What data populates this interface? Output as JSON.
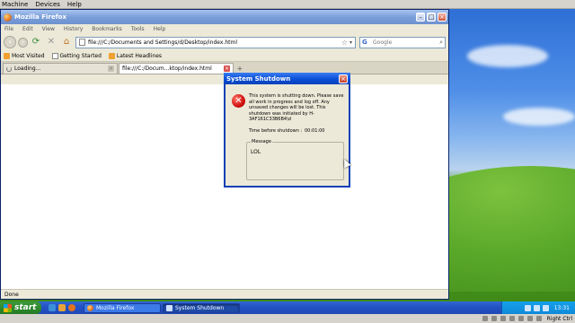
{
  "host": {
    "menu": [
      "Machine",
      "Devices",
      "Help"
    ],
    "status_right": "Right Ctrl"
  },
  "firefox": {
    "title": "Mozilla Firefox",
    "menu": [
      "File",
      "Edit",
      "View",
      "History",
      "Bookmarks",
      "Tools",
      "Help"
    ],
    "url": "file:///C:/Documents and Settings/d/Desktop/index.html",
    "search_placeholder": "Google",
    "bookmarks": [
      "Most Visited",
      "Getting Started",
      "Latest Headlines"
    ],
    "tabs": [
      {
        "label": "Loading..."
      },
      {
        "label": "file:///C:/Docum...ktop/index.html"
      }
    ],
    "status": "Done"
  },
  "dialog": {
    "title": "System Shutdown",
    "message": "This system is shutting down. Please save all work in progress and log off. Any unsaved changes will be lost. This shutdown was initiated by H-3AF161C33B6B4\\d",
    "time_label": "Time before shutdown :",
    "time_value": "00:01:00",
    "message_group_label": "Message",
    "message_group_body": "LOL"
  },
  "taskbar": {
    "start_label": "start",
    "buttons": [
      {
        "label": "Mozilla Firefox"
      },
      {
        "label": "System Shutdown"
      }
    ],
    "clock": "13:31"
  },
  "colors": {
    "xp_blue": "#245edb",
    "start_green": "#2e8a2e",
    "dialog_title": "#0a50d8",
    "error_red": "#d01010"
  },
  "icons": {
    "dialog": "error-icon",
    "firefox": "firefox-icon"
  }
}
